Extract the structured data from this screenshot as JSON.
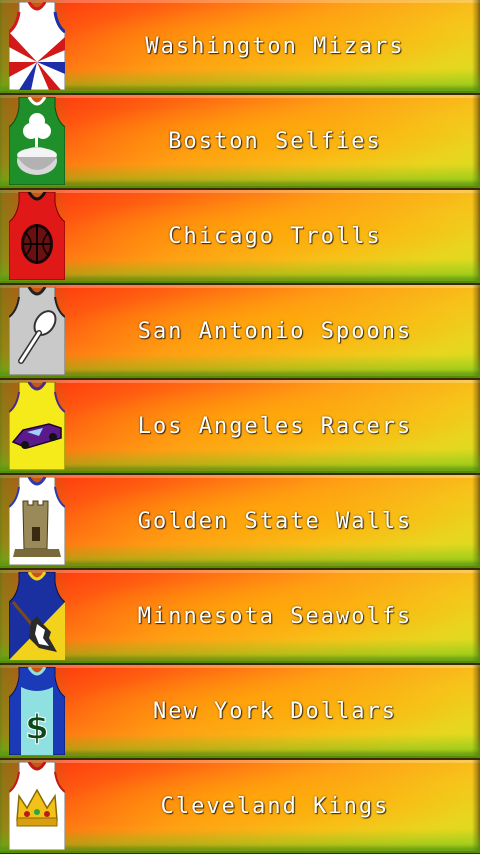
{
  "teams": [
    {
      "name": "Washington Mizars",
      "icon": "sunburst-logo"
    },
    {
      "name": "Boston Selfies",
      "icon": "shamrock-bowl-logo"
    },
    {
      "name": "Chicago Trolls",
      "icon": "basketball-logo"
    },
    {
      "name": "San Antonio Spoons",
      "icon": "spoon-logo"
    },
    {
      "name": "Los Angeles Racers",
      "icon": "race-car-logo"
    },
    {
      "name": "Golden State Walls",
      "icon": "castle-tower-logo"
    },
    {
      "name": "Minnesota Seawolfs",
      "icon": "wolf-logo"
    },
    {
      "name": "New York Dollars",
      "icon": "dollar-sign-logo"
    },
    {
      "name": "Cleveland Kings",
      "icon": "crown-logo"
    }
  ]
}
